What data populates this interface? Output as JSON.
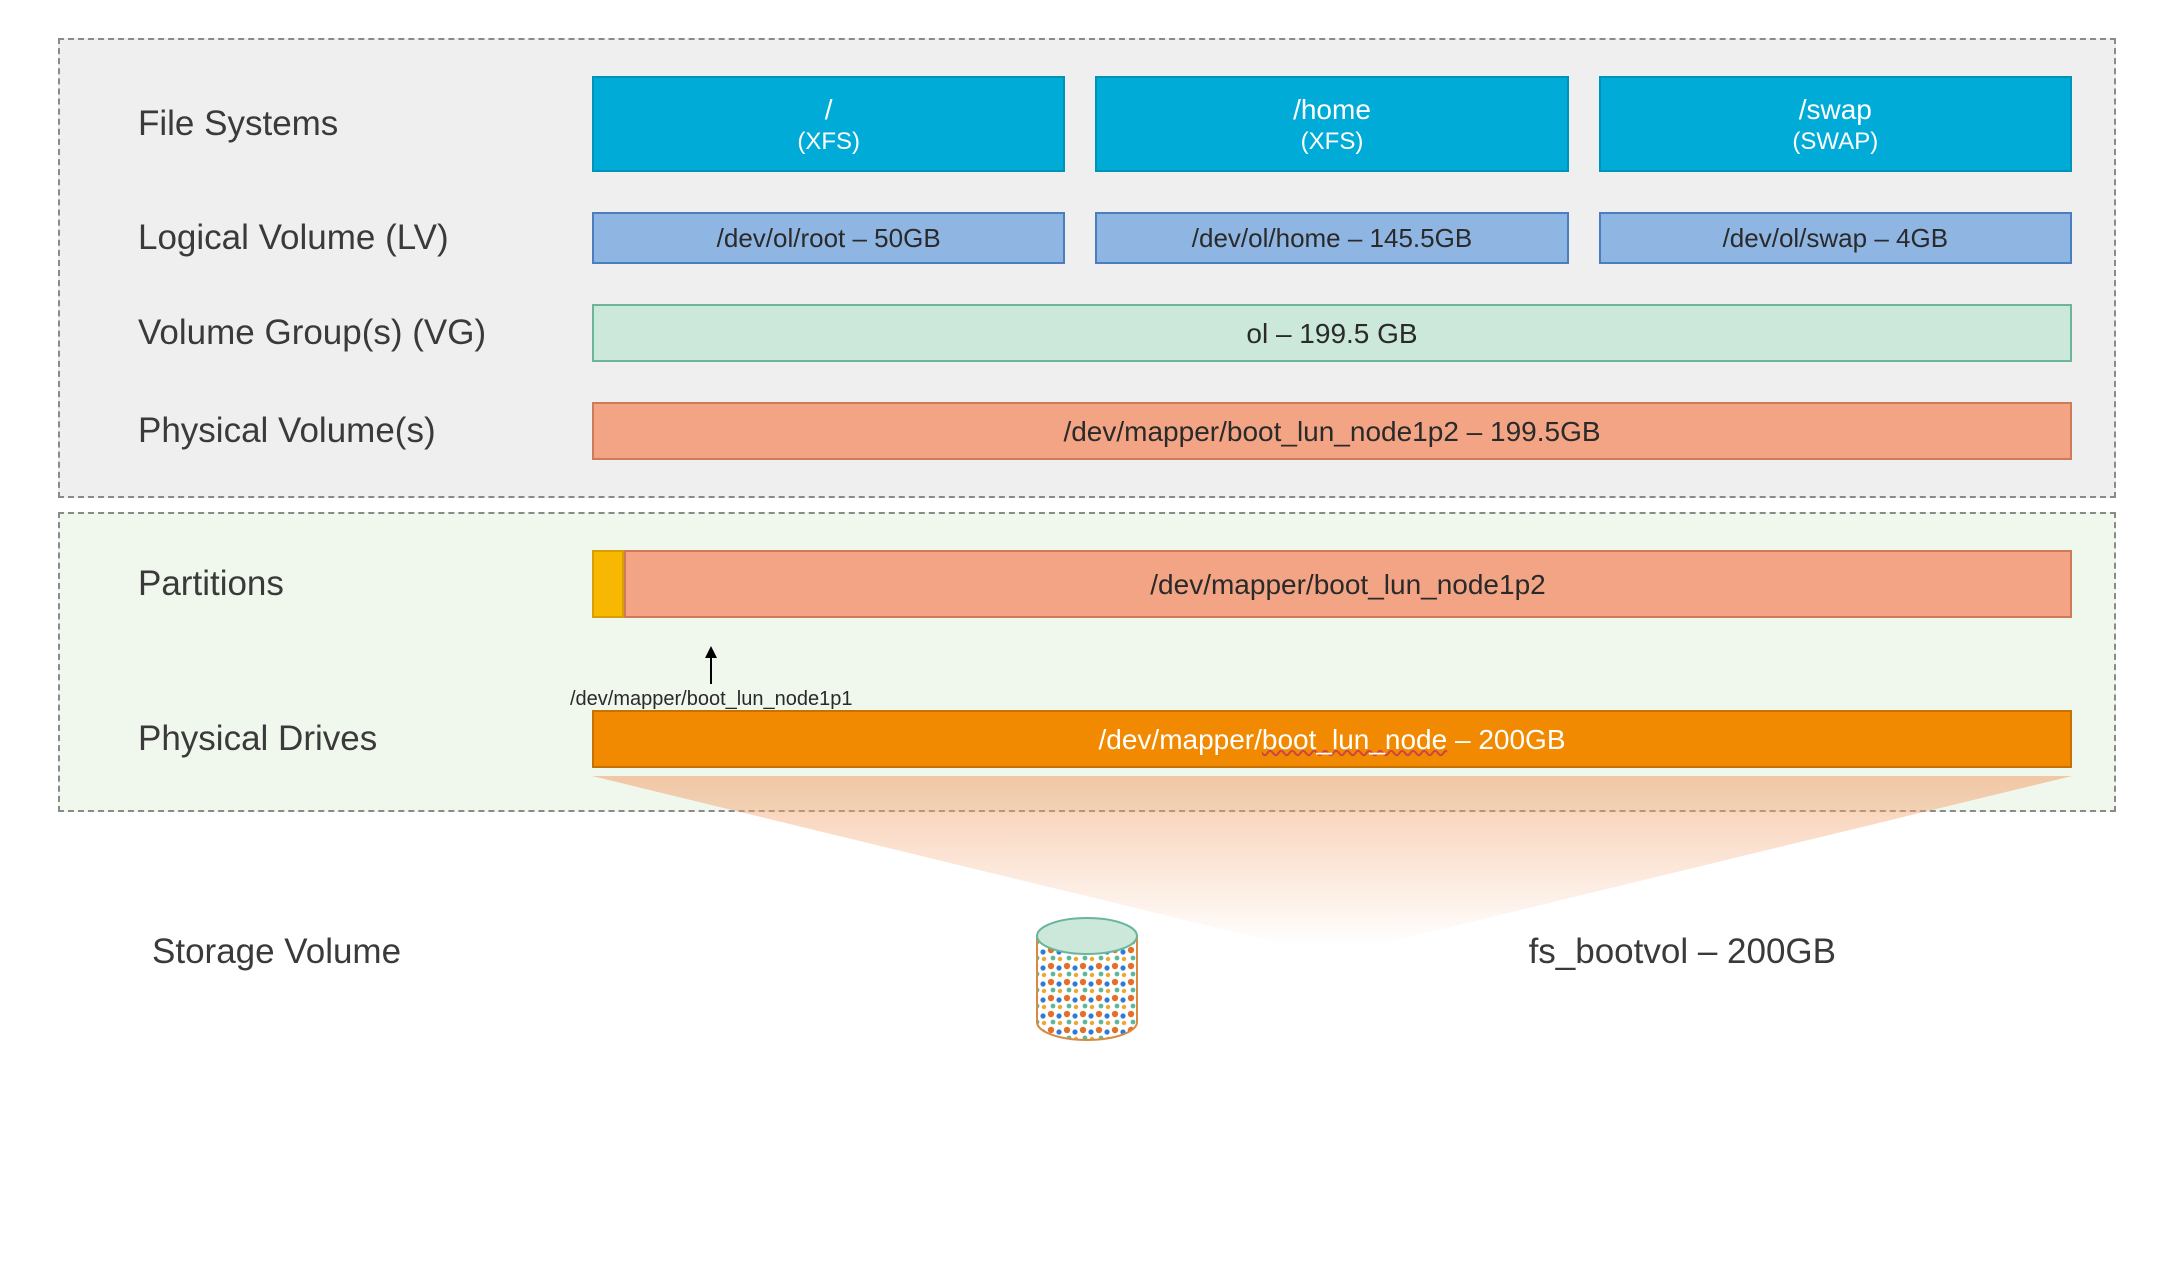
{
  "labels": {
    "file_systems": "File Systems",
    "logical_volume": "Logical Volume (LV)",
    "volume_groups": "Volume Group(s) (VG)",
    "physical_volumes": "Physical Volume(s)",
    "partitions": "Partitions",
    "physical_drives": "Physical Drives",
    "storage_volume": "Storage Volume"
  },
  "file_systems": [
    {
      "mount": "/",
      "type": "(XFS)"
    },
    {
      "mount": "/home",
      "type": "(XFS)"
    },
    {
      "mount": "/swap",
      "type": "(SWAP)"
    }
  ],
  "logical_volumes": [
    {
      "text": "/dev/ol/root – 50GB"
    },
    {
      "text": "/dev/ol/home – 145.5GB"
    },
    {
      "text": "/dev/ol/swap – 4GB"
    }
  ],
  "volume_group": {
    "text": "ol – 199.5 GB"
  },
  "physical_volume": {
    "text": "/dev/mapper/boot_lun_node1p2 – 199.5GB"
  },
  "partitions": {
    "p1_label": "/dev/mapper/boot_lun_node1p1",
    "p2_label": "/dev/mapper/boot_lun_node1p2"
  },
  "physical_drive": {
    "prefix": "/dev/mapper/",
    "device": "boot_lun_node",
    "suffix": " – 200GB"
  },
  "storage": {
    "text": "fs_bootvol – 200GB"
  },
  "colors": {
    "cyan": "#00acd7",
    "blue": "#8fb5e2",
    "mint": "#cbe8db",
    "salmon": "#f2a485",
    "orange": "#f18a00",
    "amber": "#f8b700"
  }
}
